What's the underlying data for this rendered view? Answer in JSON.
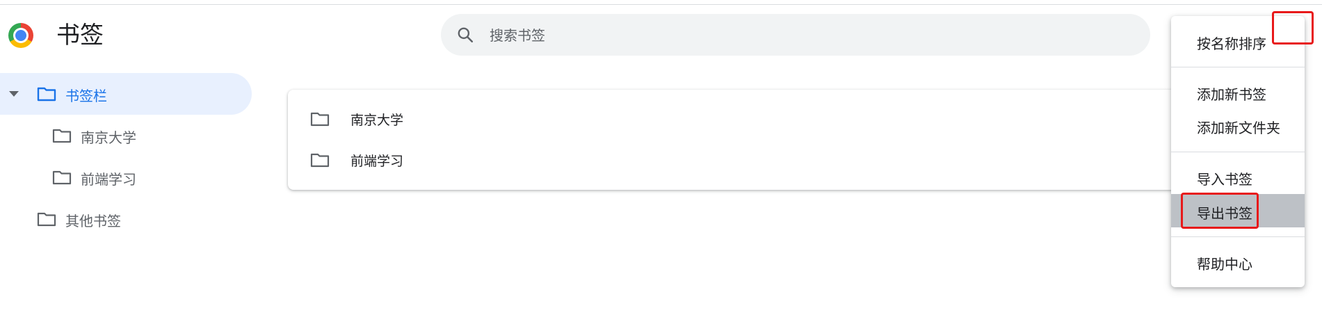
{
  "header": {
    "app_title": "书签",
    "search_placeholder": "搜索书签"
  },
  "sidebar": {
    "items": [
      {
        "label": "书签栏",
        "selected": true,
        "expanded": true
      },
      {
        "label": "南京大学"
      },
      {
        "label": "前端学习"
      },
      {
        "label": "其他书签"
      }
    ]
  },
  "main": {
    "items": [
      {
        "label": "南京大学"
      },
      {
        "label": "前端学习"
      }
    ]
  },
  "menu": {
    "items": [
      {
        "label": "按名称排序"
      },
      {
        "label": "添加新书签"
      },
      {
        "label": "添加新文件夹"
      },
      {
        "label": "导入书签"
      },
      {
        "label": "导出书签",
        "highlighted": true
      },
      {
        "label": "帮助中心"
      }
    ]
  },
  "colors": {
    "accent": "#1a73e8",
    "selected_bg": "#e8f0fe",
    "menu_highlight": "#bdc1c6",
    "annotation_red": "#e8191a",
    "search_bg": "#f1f3f4"
  }
}
